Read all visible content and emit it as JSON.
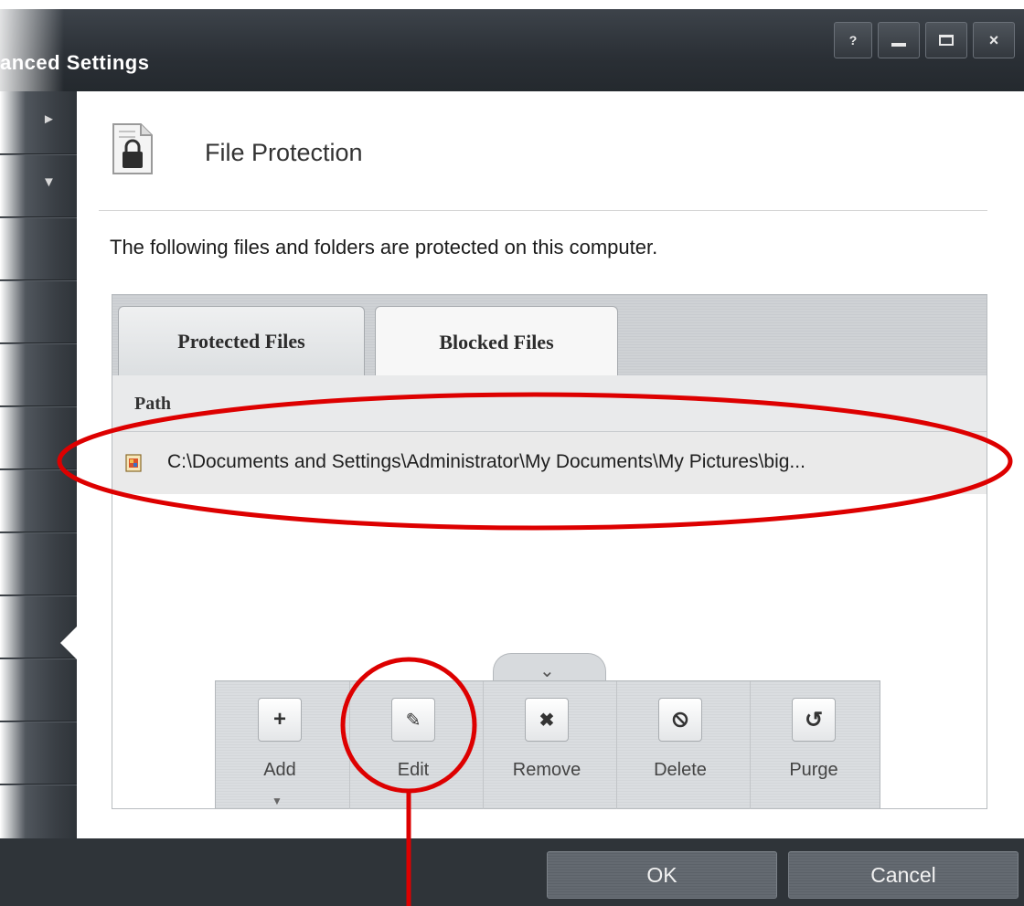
{
  "window": {
    "title": "anced Settings",
    "controls": {
      "help": "?",
      "close": "×"
    }
  },
  "sidebar": {
    "arrows": [
      "►",
      "▼"
    ]
  },
  "panel": {
    "heading": "File Protection",
    "description": "The following files and folders are protected on this computer.",
    "tabs": [
      {
        "label": "Protected Files"
      },
      {
        "label": "Blocked Files"
      }
    ],
    "column_header": "Path",
    "rows": [
      {
        "path": "C:\\Documents and Settings\\Administrator\\My Documents\\My Pictures\\big..."
      }
    ]
  },
  "toolbar": {
    "items": [
      {
        "label": "Add",
        "icon": "plus-icon",
        "glyph": "+"
      },
      {
        "label": "Edit",
        "icon": "pencil-icon",
        "glyph": "✎"
      },
      {
        "label": "Remove",
        "icon": "x-icon",
        "glyph": "✖"
      },
      {
        "label": "Delete",
        "icon": "ban-icon",
        "glyph": "⃠"
      },
      {
        "label": "Purge",
        "icon": "refresh-icon",
        "glyph": "↺"
      }
    ]
  },
  "footer": {
    "ok_label": "OK",
    "cancel_label": "Cancel"
  },
  "annotations": {
    "color": "#dd0000"
  }
}
